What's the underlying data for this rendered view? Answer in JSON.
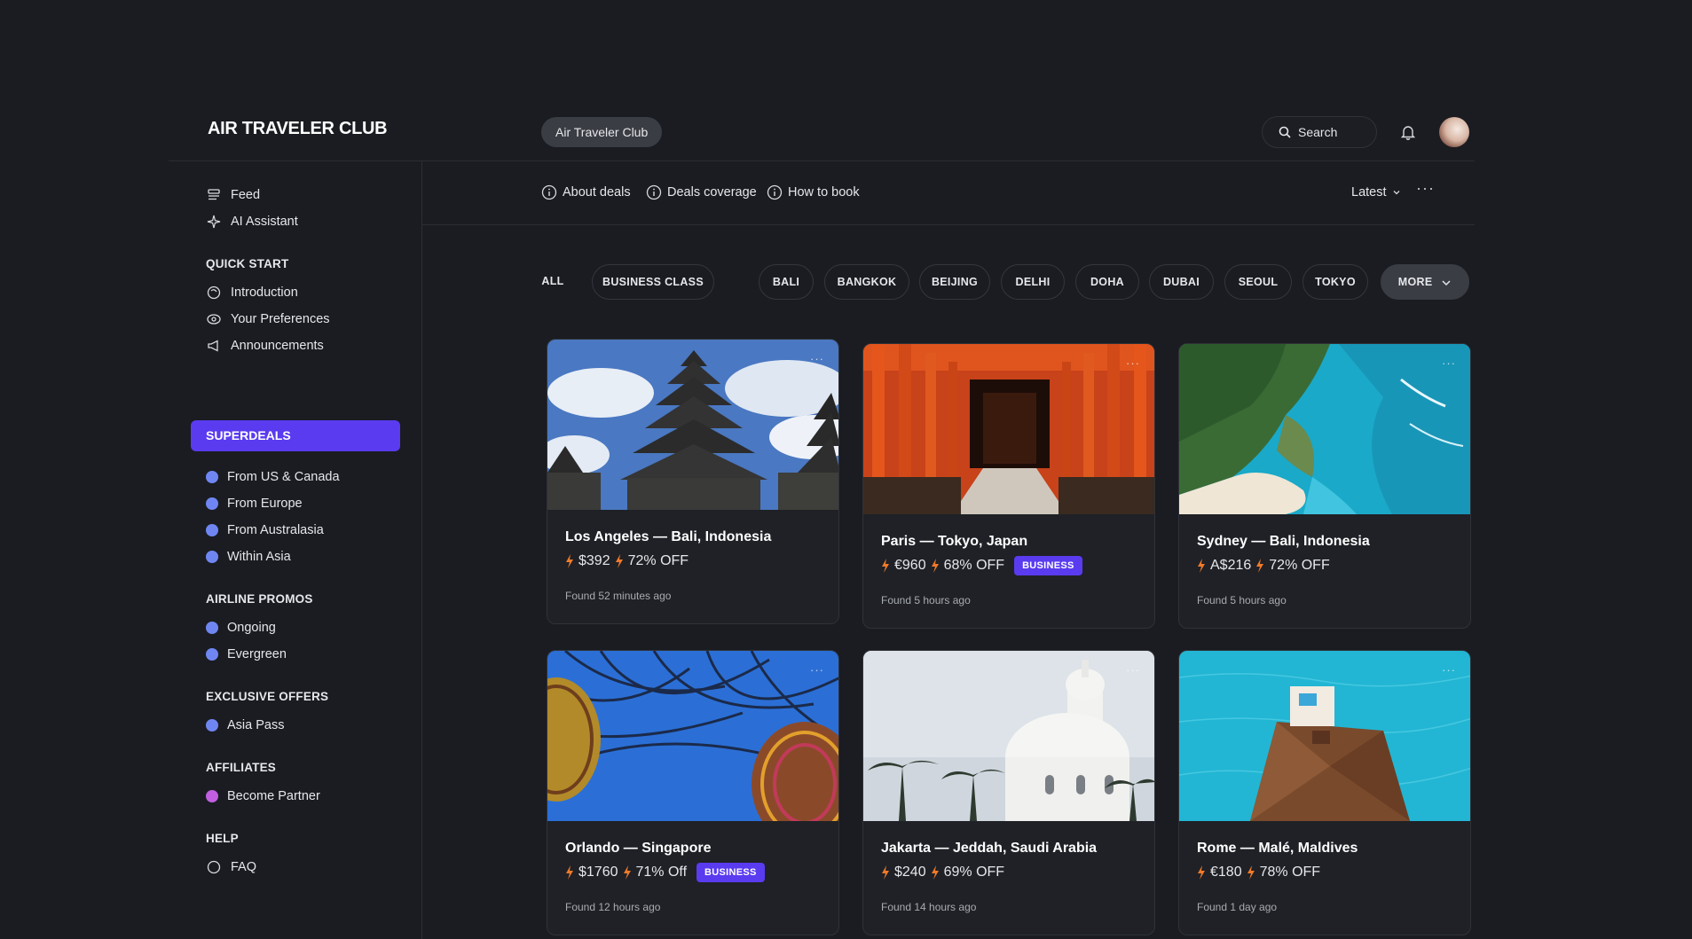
{
  "header": {
    "logo": "AIR TRAVELER CLUB",
    "club_pill": "Air Traveler Club",
    "search_label": "Search"
  },
  "sidebar": {
    "top_items": [
      {
        "label": "Feed",
        "icon": "feed-icon"
      },
      {
        "label": "AI Assistant",
        "icon": "sparkle-icon"
      }
    ],
    "quick_start": {
      "heading": "QUICK START",
      "items": [
        {
          "label": "Introduction",
          "icon": "wave-icon"
        },
        {
          "label": "Your Preferences",
          "icon": "eye-icon"
        },
        {
          "label": "Announcements",
          "icon": "megaphone-icon"
        }
      ]
    },
    "superdeals": {
      "heading": "SUPERDEALS",
      "items": [
        "From US & Canada",
        "From Europe",
        "From Australasia",
        "Within Asia"
      ]
    },
    "airline_promos": {
      "heading": "AIRLINE PROMOS",
      "items": [
        "Ongoing",
        "Evergreen"
      ]
    },
    "exclusive_offers": {
      "heading": "EXCLUSIVE OFFERS",
      "items": [
        "Asia Pass"
      ]
    },
    "affiliates": {
      "heading": "AFFILIATES",
      "items": [
        "Become Partner"
      ]
    },
    "help": {
      "heading": "HELP",
      "items": [
        "FAQ"
      ]
    }
  },
  "subnav": {
    "links": [
      "About deals",
      "Deals coverage",
      "How to book"
    ],
    "sort_label": "Latest"
  },
  "filters": {
    "chips": [
      "ALL",
      "BUSINESS CLASS",
      "BALI",
      "BANGKOK",
      "BEIJING",
      "DELHI",
      "DOHA",
      "DUBAI",
      "SEOUL",
      "TOKYO"
    ],
    "more_label": "MORE"
  },
  "cards": [
    {
      "title": "Los Angeles — Bali, Indonesia",
      "price": "$392",
      "discount": "72% OFF",
      "badge": "",
      "found": "Found 52 minutes ago"
    },
    {
      "title": "Paris — Tokyo, Japan",
      "price": "€960",
      "discount": "68% OFF",
      "badge": "BUSINESS",
      "found": "Found 5 hours ago"
    },
    {
      "title": "Sydney — Bali, Indonesia",
      "price": "A$216",
      "discount": "72% OFF",
      "badge": "",
      "found": "Found 5 hours ago"
    },
    {
      "title": "Orlando — Singapore",
      "price": "$1760",
      "discount": "71% Off",
      "badge": "BUSINESS",
      "found": "Found 12 hours ago"
    },
    {
      "title": "Jakarta — Jeddah, Saudi Arabia",
      "price": "$240",
      "discount": "69% OFF",
      "badge": "",
      "found": "Found 14 hours ago"
    },
    {
      "title": "Rome — Malé, Maldives",
      "price": "€180",
      "discount": "78% OFF",
      "badge": "",
      "found": "Found 1 day ago"
    }
  ],
  "colors": {
    "background": "#1a1c21",
    "accent": "#5a3bf0",
    "dot": "#6f86f2",
    "dot_affiliate": "#c15fe0",
    "bolt": "#f07a2a"
  }
}
